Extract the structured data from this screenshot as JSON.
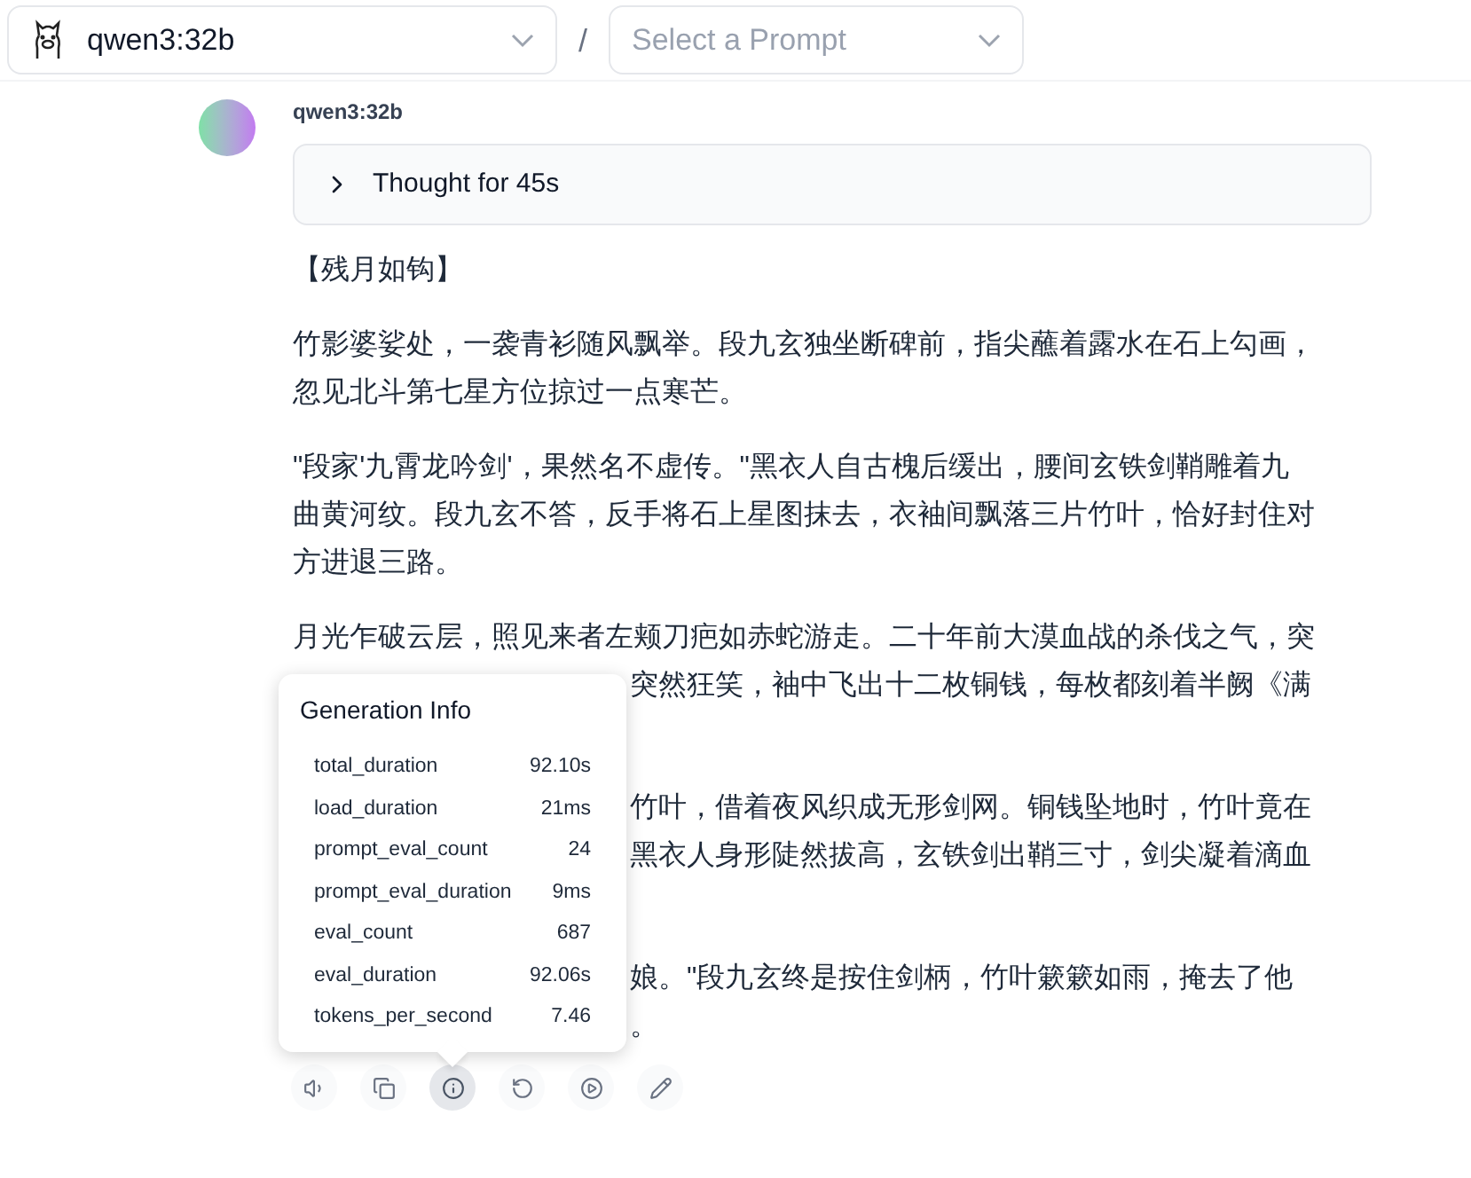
{
  "header": {
    "model_select": {
      "value": "qwen3:32b"
    },
    "separator": "/",
    "prompt_select": {
      "placeholder": "Select a Prompt"
    }
  },
  "message": {
    "author": "qwen3:32b",
    "thought": {
      "label": "Thought for 45s",
      "expanded": false
    },
    "paragraphs": [
      {
        "hidden_tail": false,
        "lines": [
          {
            "text": "【残月如钩】",
            "covered": false
          }
        ]
      },
      {
        "hidden_tail": false,
        "lines": [
          {
            "text": "竹影婆娑处，一袭青衫随风飘举。段九玄独坐断碑前，指尖蘸着露水在石上勾画，",
            "covered": false
          },
          {
            "text": "忽见北斗第七星方位掠过一点寒芒。",
            "covered": false
          }
        ]
      },
      {
        "hidden_tail": false,
        "lines": [
          {
            "text": "\"段家'九霄龙吟剑'，果然名不虚传。\"黑衣人自古槐后缓出，腰间玄铁剑鞘雕着九",
            "covered": false
          },
          {
            "text": "曲黄河纹。段九玄不答，反手将石上星图抹去，衣袖间飘落三片竹叶，恰好封住对",
            "covered": false
          },
          {
            "text": "方进退三路。",
            "covered": false
          }
        ]
      },
      {
        "hidden_tail": true,
        "lines": [
          {
            "text": "月光乍破云层，照见来者左颊刀疤如赤蛇游走。二十年前大漠血战的杀伐之气，突",
            "covered": false
          },
          {
            "text": "突然狂笑，袖中飞出十二枚铜钱，每枚都刻着半阙《满",
            "covered": true
          }
        ]
      },
      {
        "hidden_tail": true,
        "lines": [
          {
            "text": "竹叶，借着夜风织成无形剑网。铜钱坠地时，竹叶竟在",
            "covered": true
          },
          {
            "text": "黑衣人身形陡然拔高，玄铁剑出鞘三寸，剑尖凝着滴血",
            "covered": true
          }
        ]
      },
      {
        "hidden_tail": false,
        "lines": [
          {
            "text": "娘。\"段九玄终是按住剑柄，竹叶簌簌如雨，掩去了他",
            "covered": true
          },
          {
            "text": "。",
            "covered": true
          }
        ]
      }
    ],
    "generation_info": {
      "title": "Generation Info",
      "stats": [
        {
          "key": "total_duration",
          "value": "92.10s"
        },
        {
          "key": "load_duration",
          "value": "21ms"
        },
        {
          "key": "prompt_eval_count",
          "value": "24"
        },
        {
          "key": "prompt_eval_duration",
          "value": "9ms"
        },
        {
          "key": "eval_count",
          "value": "687"
        },
        {
          "key": "eval_duration",
          "value": "92.06s"
        },
        {
          "key": "tokens_per_second",
          "value": "7.46"
        }
      ]
    },
    "actions": [
      {
        "kind": "speak",
        "selected": false
      },
      {
        "kind": "copy",
        "selected": false
      },
      {
        "kind": "info",
        "selected": true
      },
      {
        "kind": "regenerate",
        "selected": false
      },
      {
        "kind": "continue",
        "selected": false
      },
      {
        "kind": "edit",
        "selected": false
      }
    ]
  }
}
